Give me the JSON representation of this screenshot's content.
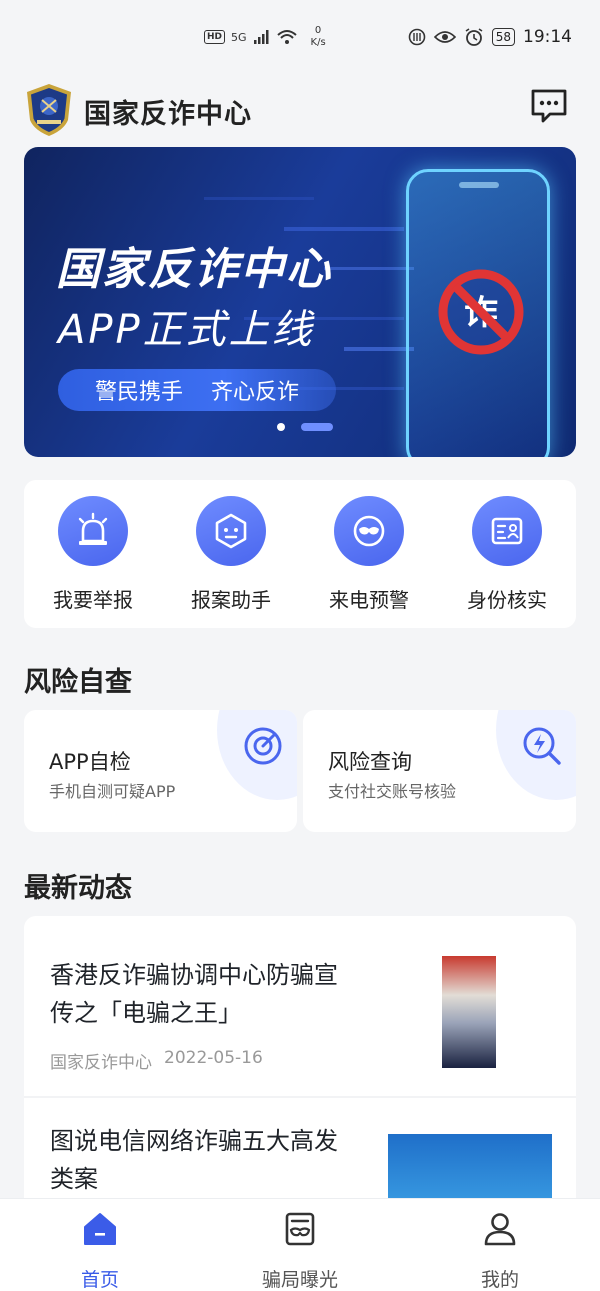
{
  "status_bar": {
    "hd": "HD",
    "network": "5G",
    "speed_value": "0",
    "speed_unit": "K/s",
    "battery": "58",
    "time": "19:14"
  },
  "header": {
    "title": "国家反诈中心"
  },
  "banner": {
    "title": "国家反诈中心",
    "subtitle": "APP正式上线",
    "slogan_1": "警民携手",
    "slogan_2": "齐心反诈",
    "sign_char": "诈"
  },
  "quick_actions": [
    {
      "label": "我要举报",
      "icon": "alarm-icon"
    },
    {
      "label": "报案助手",
      "icon": "robot-icon"
    },
    {
      "label": "来电预警",
      "icon": "mask-icon"
    },
    {
      "label": "身份核实",
      "icon": "id-card-icon"
    }
  ],
  "risk_section": {
    "title": "风险自查",
    "cards": [
      {
        "title": "APP自检",
        "subtitle": "手机自测可疑APP",
        "icon": "target-icon"
      },
      {
        "title": "风险查询",
        "subtitle": "支付社交账号核验",
        "icon": "search-flash-icon"
      }
    ]
  },
  "news_section": {
    "title": "最新动态",
    "items": [
      {
        "title_line1": "香港反诈骗协调中心防骗宣",
        "title_line2": "传之「电骗之王」",
        "source": "国家反诈中心",
        "date": "2022-05-16"
      },
      {
        "title_line1": "图说电信网络诈骗五大高发",
        "title_line2": "类案"
      }
    ]
  },
  "tabs": [
    {
      "label": "首页",
      "icon": "home-icon",
      "active": true
    },
    {
      "label": "骗局曝光",
      "icon": "news-mask-icon",
      "active": false
    },
    {
      "label": "我的",
      "icon": "user-icon",
      "active": false
    }
  ],
  "colors": {
    "accent": "#3b5ce8",
    "banner_dark": "#10245f",
    "sign_red": "#e03535"
  }
}
